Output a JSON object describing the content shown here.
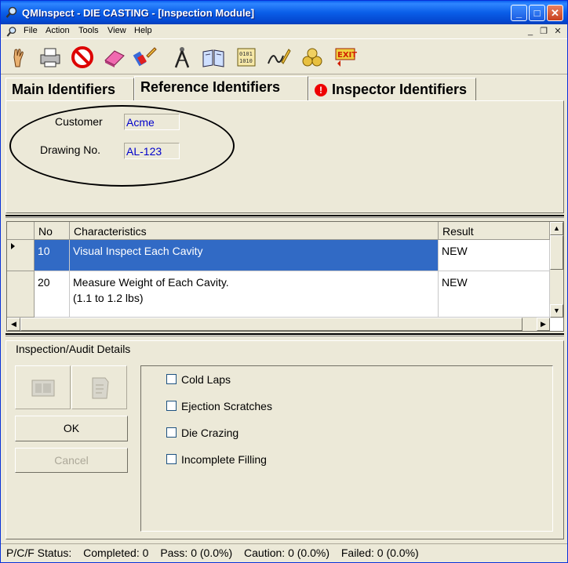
{
  "window": {
    "title": "QMInspect - DIE CASTING - [Inspection Module]"
  },
  "menu": [
    "File",
    "Action",
    "Tools",
    "View",
    "Help"
  ],
  "toolbar": [
    "hand-icon",
    "printer-icon",
    "no-sign-icon",
    "eraser-icon",
    "brush-icon",
    "compass-icon",
    "book-icon",
    "data-icon",
    "signature-icon",
    "coins-icon",
    "exit-icon"
  ],
  "tabs": [
    {
      "label": "Main Identifiers"
    },
    {
      "label": "Reference Identifiers"
    },
    {
      "label": "Inspector Identifiers",
      "warn": "!"
    }
  ],
  "reference": {
    "customer_label": "Customer",
    "customer_value": "Acme",
    "drawing_label": "Drawing No.",
    "drawing_value": "AL-123"
  },
  "grid": {
    "columns": [
      "No",
      "Characteristics",
      "Result"
    ],
    "rows": [
      {
        "no": "10",
        "characteristic": "Visual Inspect Each Cavity",
        "characteristic_line2": "",
        "result": "NEW",
        "selected": true
      },
      {
        "no": "20",
        "characteristic": "Measure Weight of Each Cavity.",
        "characteristic_line2": "(1.1 to 1.2 lbs)",
        "result": "NEW",
        "selected": false
      }
    ]
  },
  "details": {
    "title": "Inspection/Audit Details",
    "ok_label": "OK",
    "cancel_label": "Cancel",
    "checks": [
      "Cold Laps",
      "Ejection Scratches",
      "Die Crazing",
      "Incomplete Filling"
    ]
  },
  "status": {
    "label": "P/C/F Status:",
    "completed": "Completed: 0",
    "pass": "Pass: 0 (0.0%)",
    "caution": "Caution: 0 (0.0%)",
    "failed": "Failed: 0 (0.0%)"
  }
}
